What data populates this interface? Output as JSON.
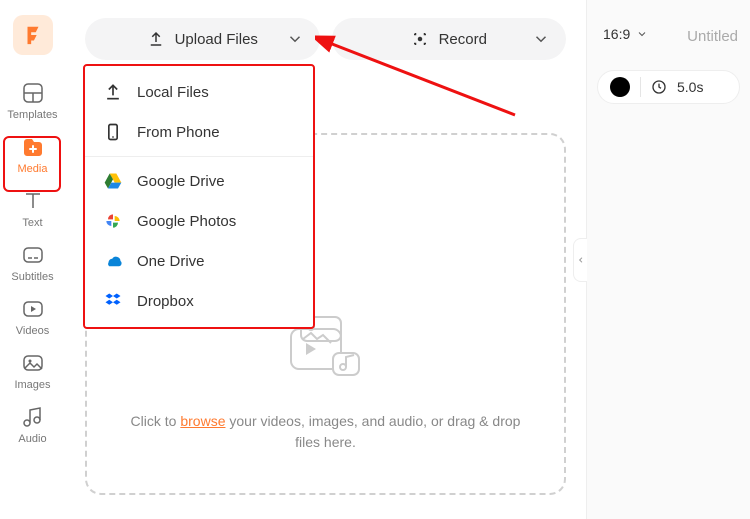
{
  "sidebar": {
    "items": [
      {
        "label": "Templates"
      },
      {
        "label": "Media"
      },
      {
        "label": "Text"
      },
      {
        "label": "Subtitles"
      },
      {
        "label": "Videos"
      },
      {
        "label": "Images"
      },
      {
        "label": "Audio"
      }
    ]
  },
  "toolbar": {
    "upload_label": "Upload Files",
    "record_label": "Record"
  },
  "dropdown": {
    "groups": [
      [
        {
          "label": "Local Files"
        },
        {
          "label": "From Phone"
        }
      ],
      [
        {
          "label": "Google Drive"
        },
        {
          "label": "Google Photos"
        },
        {
          "label": "One Drive"
        },
        {
          "label": "Dropbox"
        }
      ]
    ]
  },
  "dropzone": {
    "prefix": "Click to ",
    "browse": "browse",
    "suffix": " your videos, images, and audio, or drag & drop files here."
  },
  "right": {
    "aspect": "16:9",
    "title": "Untitled",
    "duration": "5.0s"
  }
}
